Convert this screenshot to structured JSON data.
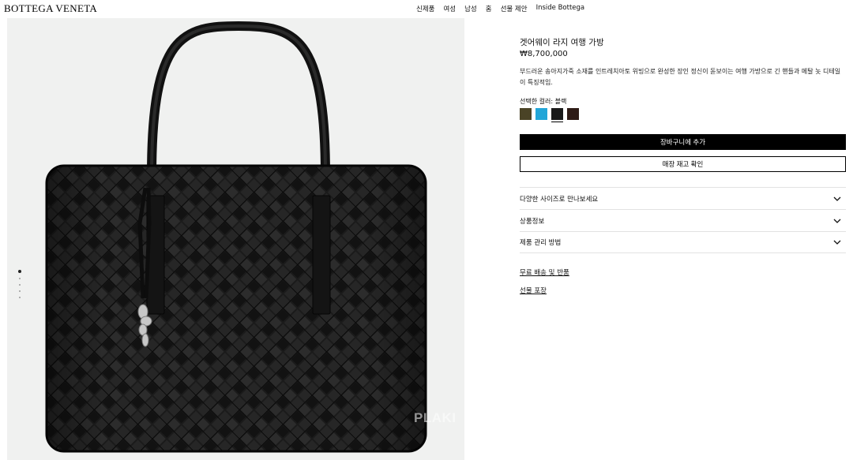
{
  "header": {
    "logo": "BOTTEGA VENETA",
    "nav": [
      "신제품",
      "여성",
      "남성",
      "홈",
      "선물 제안",
      "Inside Bottega"
    ]
  },
  "gallery": {
    "watermark": "PLAKI",
    "slide_count": 5,
    "active_slide": 1
  },
  "product": {
    "title": "겟어웨이 라지 여행 가방",
    "price": "₩8,700,000",
    "description": "부드러운 송아지가죽 소재를 인트레치아토 위빙으로 완성한 장인 정신이 돋보이는 여행 가방으로 긴 핸들과 메탈 놋 디테일이 특징적임.",
    "color_label": "선택한 컬러: 블랙",
    "swatches": [
      {
        "name": "olive",
        "color": "#4a4326"
      },
      {
        "name": "turquoise",
        "color": "#22a6d8"
      },
      {
        "name": "black",
        "color": "#1a1a1a",
        "selected": true
      },
      {
        "name": "dark-brown",
        "color": "#2e1b16"
      }
    ],
    "add_to_cart": "장바구니에 추가",
    "check_store": "매장 재고 확인",
    "accordion": [
      "다양한 사이즈로 만나보세요",
      "상품정보",
      "제품 관리 방법"
    ],
    "links": [
      "무료 배송 및 반품",
      "선물 포장"
    ]
  },
  "colors": {
    "accent": "#000000",
    "image_bg": "#f0f1f0"
  }
}
